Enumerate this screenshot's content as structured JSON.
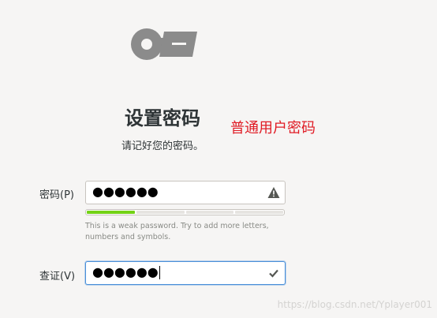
{
  "dialog": {
    "title": "设置密码",
    "subtitle": "请记好您的密码。",
    "annotation": "普通用户密码"
  },
  "password": {
    "label": "密码(P)",
    "masked_value": "●●●●●●",
    "status_icon": "warning-icon",
    "strength": {
      "level": 1,
      "max": 4,
      "hint": "This is a weak password. Try to add more letters, numbers and symbols."
    }
  },
  "confirm": {
    "label": "查证(V)",
    "masked_value": "●●●●●●",
    "status_icon": "checkmark-icon"
  },
  "watermark": "https://blog.csdn.net/Yplayer001",
  "colors": {
    "accent": "#4a90d9",
    "annotation": "#e01b24",
    "strength_bar": "#73d216"
  }
}
